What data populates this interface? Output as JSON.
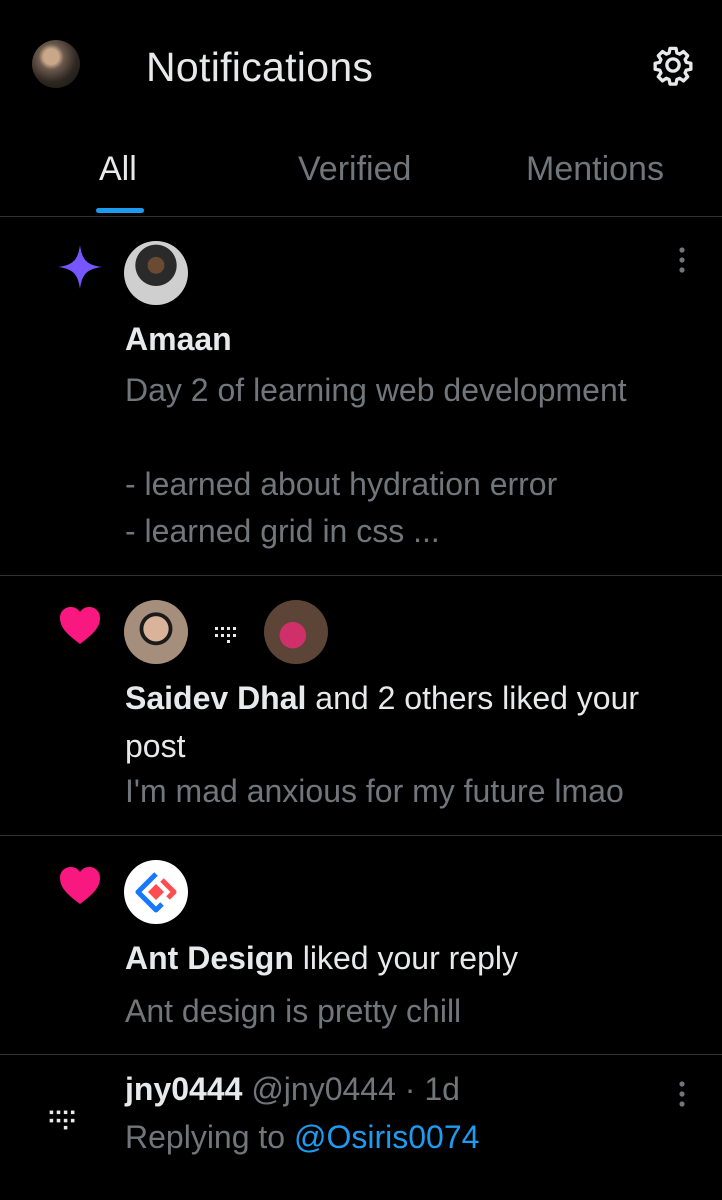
{
  "header": {
    "title": "Notifications",
    "tabs": [
      {
        "label": "All",
        "active": true
      },
      {
        "label": "Verified",
        "active": false
      },
      {
        "label": "Mentions",
        "active": false
      }
    ]
  },
  "notifications": [
    {
      "type_icon": "sparkle-icon",
      "name": "Amaan",
      "lines": [
        "Day 2 of learning web development",
        "",
        "- learned about hydration error",
        "- learned grid in css ..."
      ]
    },
    {
      "type_icon": "heart-icon",
      "actor": "Saidev Dhal",
      "action": " and 2 others liked your post",
      "snippet": "I'm mad anxious for my future lmao"
    },
    {
      "type_icon": "heart-icon",
      "actor": "Ant Design",
      "action": " liked your reply",
      "snippet": "Ant design is pretty chill"
    },
    {
      "type_icon": "more-dots-icon",
      "name": "jny0444",
      "handle": "@jny0444",
      "separator": " · ",
      "time": "1d",
      "reply_prefix": "Replying to ",
      "reply_to": "@Osiris0074"
    }
  ],
  "colors": {
    "accent": "#1d9bf0",
    "like": "#f91880",
    "sparkle": "#7856ff",
    "muted": "#71767b"
  }
}
